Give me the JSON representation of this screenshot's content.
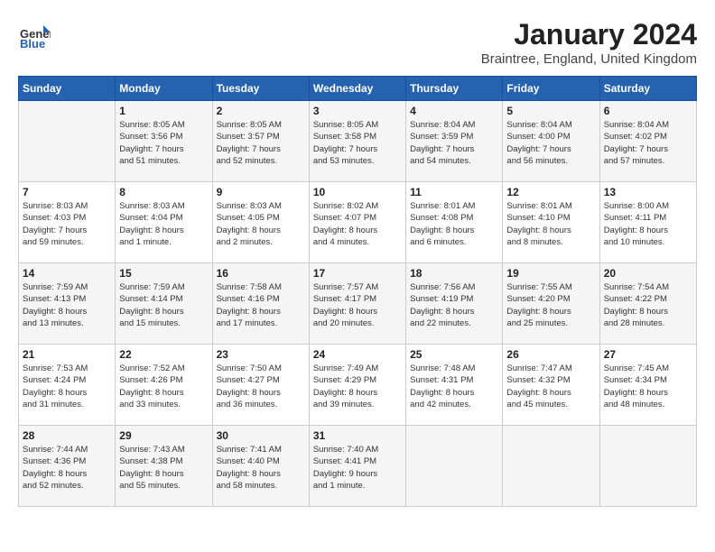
{
  "header": {
    "logo_general": "General",
    "logo_blue": "Blue",
    "month_title": "January 2024",
    "location": "Braintree, England, United Kingdom"
  },
  "weekdays": [
    "Sunday",
    "Monday",
    "Tuesday",
    "Wednesday",
    "Thursday",
    "Friday",
    "Saturday"
  ],
  "weeks": [
    [
      {
        "day": "",
        "info": ""
      },
      {
        "day": "1",
        "info": "Sunrise: 8:05 AM\nSunset: 3:56 PM\nDaylight: 7 hours\nand 51 minutes."
      },
      {
        "day": "2",
        "info": "Sunrise: 8:05 AM\nSunset: 3:57 PM\nDaylight: 7 hours\nand 52 minutes."
      },
      {
        "day": "3",
        "info": "Sunrise: 8:05 AM\nSunset: 3:58 PM\nDaylight: 7 hours\nand 53 minutes."
      },
      {
        "day": "4",
        "info": "Sunrise: 8:04 AM\nSunset: 3:59 PM\nDaylight: 7 hours\nand 54 minutes."
      },
      {
        "day": "5",
        "info": "Sunrise: 8:04 AM\nSunset: 4:00 PM\nDaylight: 7 hours\nand 56 minutes."
      },
      {
        "day": "6",
        "info": "Sunrise: 8:04 AM\nSunset: 4:02 PM\nDaylight: 7 hours\nand 57 minutes."
      }
    ],
    [
      {
        "day": "7",
        "info": "Sunrise: 8:03 AM\nSunset: 4:03 PM\nDaylight: 7 hours\nand 59 minutes."
      },
      {
        "day": "8",
        "info": "Sunrise: 8:03 AM\nSunset: 4:04 PM\nDaylight: 8 hours\nand 1 minute."
      },
      {
        "day": "9",
        "info": "Sunrise: 8:03 AM\nSunset: 4:05 PM\nDaylight: 8 hours\nand 2 minutes."
      },
      {
        "day": "10",
        "info": "Sunrise: 8:02 AM\nSunset: 4:07 PM\nDaylight: 8 hours\nand 4 minutes."
      },
      {
        "day": "11",
        "info": "Sunrise: 8:01 AM\nSunset: 4:08 PM\nDaylight: 8 hours\nand 6 minutes."
      },
      {
        "day": "12",
        "info": "Sunrise: 8:01 AM\nSunset: 4:10 PM\nDaylight: 8 hours\nand 8 minutes."
      },
      {
        "day": "13",
        "info": "Sunrise: 8:00 AM\nSunset: 4:11 PM\nDaylight: 8 hours\nand 10 minutes."
      }
    ],
    [
      {
        "day": "14",
        "info": "Sunrise: 7:59 AM\nSunset: 4:13 PM\nDaylight: 8 hours\nand 13 minutes."
      },
      {
        "day": "15",
        "info": "Sunrise: 7:59 AM\nSunset: 4:14 PM\nDaylight: 8 hours\nand 15 minutes."
      },
      {
        "day": "16",
        "info": "Sunrise: 7:58 AM\nSunset: 4:16 PM\nDaylight: 8 hours\nand 17 minutes."
      },
      {
        "day": "17",
        "info": "Sunrise: 7:57 AM\nSunset: 4:17 PM\nDaylight: 8 hours\nand 20 minutes."
      },
      {
        "day": "18",
        "info": "Sunrise: 7:56 AM\nSunset: 4:19 PM\nDaylight: 8 hours\nand 22 minutes."
      },
      {
        "day": "19",
        "info": "Sunrise: 7:55 AM\nSunset: 4:20 PM\nDaylight: 8 hours\nand 25 minutes."
      },
      {
        "day": "20",
        "info": "Sunrise: 7:54 AM\nSunset: 4:22 PM\nDaylight: 8 hours\nand 28 minutes."
      }
    ],
    [
      {
        "day": "21",
        "info": "Sunrise: 7:53 AM\nSunset: 4:24 PM\nDaylight: 8 hours\nand 31 minutes."
      },
      {
        "day": "22",
        "info": "Sunrise: 7:52 AM\nSunset: 4:26 PM\nDaylight: 8 hours\nand 33 minutes."
      },
      {
        "day": "23",
        "info": "Sunrise: 7:50 AM\nSunset: 4:27 PM\nDaylight: 8 hours\nand 36 minutes."
      },
      {
        "day": "24",
        "info": "Sunrise: 7:49 AM\nSunset: 4:29 PM\nDaylight: 8 hours\nand 39 minutes."
      },
      {
        "day": "25",
        "info": "Sunrise: 7:48 AM\nSunset: 4:31 PM\nDaylight: 8 hours\nand 42 minutes."
      },
      {
        "day": "26",
        "info": "Sunrise: 7:47 AM\nSunset: 4:32 PM\nDaylight: 8 hours\nand 45 minutes."
      },
      {
        "day": "27",
        "info": "Sunrise: 7:45 AM\nSunset: 4:34 PM\nDaylight: 8 hours\nand 48 minutes."
      }
    ],
    [
      {
        "day": "28",
        "info": "Sunrise: 7:44 AM\nSunset: 4:36 PM\nDaylight: 8 hours\nand 52 minutes."
      },
      {
        "day": "29",
        "info": "Sunrise: 7:43 AM\nSunset: 4:38 PM\nDaylight: 8 hours\nand 55 minutes."
      },
      {
        "day": "30",
        "info": "Sunrise: 7:41 AM\nSunset: 4:40 PM\nDaylight: 8 hours\nand 58 minutes."
      },
      {
        "day": "31",
        "info": "Sunrise: 7:40 AM\nSunset: 4:41 PM\nDaylight: 9 hours\nand 1 minute."
      },
      {
        "day": "",
        "info": ""
      },
      {
        "day": "",
        "info": ""
      },
      {
        "day": "",
        "info": ""
      }
    ]
  ]
}
